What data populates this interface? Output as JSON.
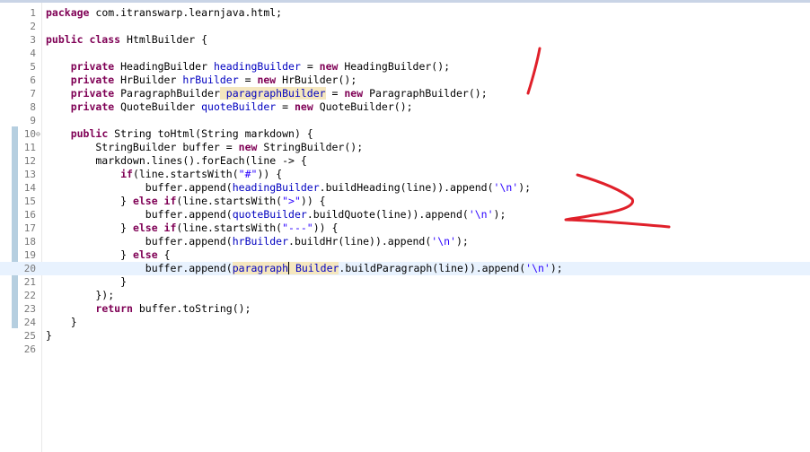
{
  "editor": {
    "lines": [
      {
        "n": "1",
        "segs": [
          [
            "k",
            "package"
          ],
          [
            "",
            "com.itranswarp.learnjava.html;"
          ]
        ]
      },
      {
        "n": "2",
        "segs": []
      },
      {
        "n": "3",
        "segs": [
          [
            "k",
            "public class"
          ],
          [
            "",
            "HtmlBuilder {"
          ]
        ]
      },
      {
        "n": "4",
        "segs": []
      },
      {
        "n": "5",
        "segs": [
          [
            "",
            "    "
          ],
          [
            "k",
            "private"
          ],
          [
            "",
            "HeadingBuilder"
          ],
          [
            "f",
            "headingBuilder"
          ],
          [
            "",
            "="
          ],
          [
            "k",
            "new"
          ],
          [
            "",
            "HeadingBuilder();"
          ]
        ]
      },
      {
        "n": "6",
        "segs": [
          [
            "",
            "    "
          ],
          [
            "k",
            "private"
          ],
          [
            "",
            "HrBuilder"
          ],
          [
            "f",
            "hrBuilder"
          ],
          [
            "",
            "="
          ],
          [
            "k",
            "new"
          ],
          [
            "",
            "HrBuilder();"
          ]
        ]
      },
      {
        "n": "7",
        "segs": [
          [
            "",
            "    "
          ],
          [
            "k",
            "private"
          ],
          [
            "",
            "ParagraphBuilder"
          ],
          [
            "f occ",
            "paragraphBuilder"
          ],
          [
            "",
            "="
          ],
          [
            "k",
            "new"
          ],
          [
            "",
            "ParagraphBuilder();"
          ]
        ]
      },
      {
        "n": "8",
        "segs": [
          [
            "",
            "    "
          ],
          [
            "k",
            "private"
          ],
          [
            "",
            "QuoteBuilder"
          ],
          [
            "f",
            "quoteBuilder"
          ],
          [
            "",
            "="
          ],
          [
            "k",
            "new"
          ],
          [
            "",
            "QuoteBuilder();"
          ]
        ]
      },
      {
        "n": "9",
        "segs": []
      },
      {
        "n": "10",
        "fold": "⊖",
        "segs": [
          [
            "",
            "    "
          ],
          [
            "k",
            "public"
          ],
          [
            "",
            "String toHtml(String markdown) {"
          ]
        ]
      },
      {
        "n": "11",
        "segs": [
          [
            "",
            "        StringBuilder buffer ="
          ],
          [
            "k",
            "new"
          ],
          [
            "",
            "StringBuilder();"
          ]
        ]
      },
      {
        "n": "12",
        "segs": [
          [
            "",
            "        markdown.lines().forEach(line -> {"
          ]
        ]
      },
      {
        "n": "13",
        "segs": [
          [
            "",
            "            "
          ],
          [
            "k",
            "if"
          ],
          [
            "",
            "(line.startsWith("
          ],
          [
            "s",
            "\"#\""
          ],
          [
            "",
            ")) {"
          ]
        ]
      },
      {
        "n": "14",
        "segs": [
          [
            "",
            "                buffer.append("
          ],
          [
            "f",
            "headingBuilder"
          ],
          [
            "",
            ".buildHeading(line)).append("
          ],
          [
            "s",
            "'\\n'"
          ],
          [
            "",
            ");"
          ]
        ]
      },
      {
        "n": "15",
        "segs": [
          [
            "",
            "            } "
          ],
          [
            "k",
            "else if"
          ],
          [
            "",
            "(line.startsWith("
          ],
          [
            "s",
            "\">\""
          ],
          [
            "",
            ")) {"
          ]
        ]
      },
      {
        "n": "16",
        "segs": [
          [
            "",
            "                buffer.append("
          ],
          [
            "f",
            "quoteBuilder"
          ],
          [
            "",
            ".buildQuote(line)).append("
          ],
          [
            "s",
            "'\\n'"
          ],
          [
            "",
            ");"
          ]
        ]
      },
      {
        "n": "17",
        "segs": [
          [
            "",
            "            } "
          ],
          [
            "k",
            "else if"
          ],
          [
            "",
            "(line.startsWith("
          ],
          [
            "s",
            "\"---\""
          ],
          [
            "",
            ")) {"
          ]
        ]
      },
      {
        "n": "18",
        "segs": [
          [
            "",
            "                buffer.append("
          ],
          [
            "f",
            "hrBuilder"
          ],
          [
            "",
            ".buildHr(line)).append("
          ],
          [
            "s",
            "'\\n'"
          ],
          [
            "",
            ");"
          ]
        ]
      },
      {
        "n": "19",
        "segs": [
          [
            "",
            "            } "
          ],
          [
            "k",
            "else"
          ],
          [
            "",
            "{"
          ]
        ]
      },
      {
        "n": "20",
        "current": true,
        "segs": [
          [
            "",
            "                buffer.append("
          ],
          [
            "f occ",
            "paragraph"
          ],
          [
            "f occ caret",
            "Builder"
          ],
          [
            "",
            ".buildParagraph(line)).append("
          ],
          [
            "s",
            "'\\n'"
          ],
          [
            "",
            ");"
          ]
        ]
      },
      {
        "n": "21",
        "segs": [
          [
            "",
            "            }"
          ]
        ]
      },
      {
        "n": "22",
        "segs": [
          [
            "",
            "        });"
          ]
        ]
      },
      {
        "n": "23",
        "segs": [
          [
            "",
            "        "
          ],
          [
            "k",
            "return"
          ],
          [
            "",
            "buffer.toString();"
          ]
        ]
      },
      {
        "n": "24",
        "segs": [
          [
            "",
            "    }"
          ]
        ]
      },
      {
        "n": "25",
        "segs": [
          [
            "",
            "}"
          ]
        ]
      },
      {
        "n": "26",
        "segs": []
      }
    ]
  },
  "annotations": {
    "color": "#e0202a",
    "marks": [
      "handwritten-one",
      "handwritten-two"
    ]
  }
}
